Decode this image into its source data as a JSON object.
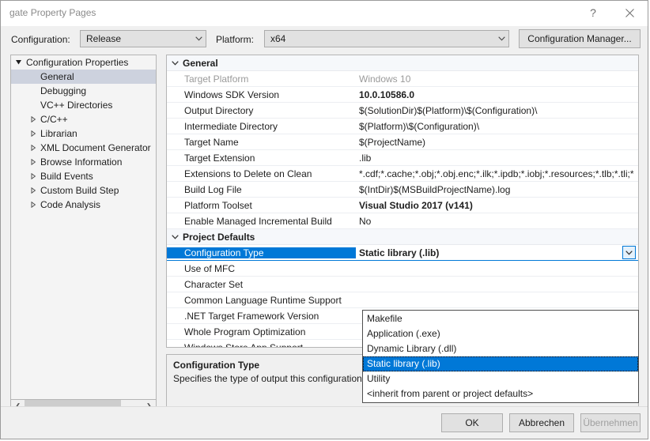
{
  "window": {
    "title": "gate Property Pages",
    "help_icon": "question-mark-icon",
    "close_icon": "close-icon"
  },
  "config_bar": {
    "configuration_label": "Configuration:",
    "configuration_value": "Release",
    "platform_label": "Platform:",
    "platform_value": "x64",
    "configuration_manager_label": "Configuration Manager..."
  },
  "tree": {
    "items": [
      {
        "label": "Configuration Properties",
        "indent": 0,
        "arrow": "expanded",
        "selected": false
      },
      {
        "label": "General",
        "indent": 1,
        "arrow": "none",
        "selected": true
      },
      {
        "label": "Debugging",
        "indent": 1,
        "arrow": "none",
        "selected": false
      },
      {
        "label": "VC++ Directories",
        "indent": 1,
        "arrow": "none",
        "selected": false
      },
      {
        "label": "C/C++",
        "indent": 1,
        "arrow": "collapsed",
        "selected": false
      },
      {
        "label": "Librarian",
        "indent": 1,
        "arrow": "collapsed",
        "selected": false
      },
      {
        "label": "XML Document Generator",
        "indent": 1,
        "arrow": "collapsed",
        "selected": false
      },
      {
        "label": "Browse Information",
        "indent": 1,
        "arrow": "collapsed",
        "selected": false
      },
      {
        "label": "Build Events",
        "indent": 1,
        "arrow": "collapsed",
        "selected": false
      },
      {
        "label": "Custom Build Step",
        "indent": 1,
        "arrow": "collapsed",
        "selected": false
      },
      {
        "label": "Code Analysis",
        "indent": 1,
        "arrow": "collapsed",
        "selected": false
      }
    ],
    "scrollbar": {
      "left_arrow_icon": "chevron-left-icon",
      "right_arrow_icon": "chevron-right-icon"
    }
  },
  "grid": {
    "sections": [
      {
        "title": "General",
        "expanded": true,
        "rows": [
          {
            "name": "Target Platform",
            "value": "Windows 10",
            "state": "readonly"
          },
          {
            "name": "Windows SDK Version",
            "value": "10.0.10586.0",
            "state": "bold"
          },
          {
            "name": "Output Directory",
            "value": "$(SolutionDir)$(Platform)\\$(Configuration)\\",
            "state": "normal"
          },
          {
            "name": "Intermediate Directory",
            "value": "$(Platform)\\$(Configuration)\\",
            "state": "normal"
          },
          {
            "name": "Target Name",
            "value": "$(ProjectName)",
            "state": "normal"
          },
          {
            "name": "Target Extension",
            "value": ".lib",
            "state": "normal"
          },
          {
            "name": "Extensions to Delete on Clean",
            "value": "*.cdf;*.cache;*.obj;*.obj.enc;*.ilk;*.ipdb;*.iobj;*.resources;*.tlb;*.tli;*",
            "state": "normal"
          },
          {
            "name": "Build Log File",
            "value": "$(IntDir)$(MSBuildProjectName).log",
            "state": "normal"
          },
          {
            "name": "Platform Toolset",
            "value": "Visual Studio 2017 (v141)",
            "state": "bold"
          },
          {
            "name": "Enable Managed Incremental Build",
            "value": "No",
            "state": "normal"
          }
        ]
      },
      {
        "title": "Project Defaults",
        "expanded": true,
        "rows": [
          {
            "name": "Configuration Type",
            "value": "Static library (.lib)",
            "state": "editing"
          },
          {
            "name": "Use of MFC",
            "value": "",
            "state": "normal"
          },
          {
            "name": "Character Set",
            "value": "",
            "state": "normal"
          },
          {
            "name": "Common Language Runtime Support",
            "value": "",
            "state": "normal"
          },
          {
            "name": ".NET Target Framework Version",
            "value": "",
            "state": "normal"
          },
          {
            "name": "Whole Program Optimization",
            "value": "",
            "state": "normal"
          },
          {
            "name": "Windows Store App Support",
            "value": "",
            "state": "normal"
          }
        ]
      }
    ],
    "expand_icon": "chevron-down-icon",
    "editor_dropdown_icon": "chevron-down-icon"
  },
  "dropdown": {
    "options": [
      "Makefile",
      "Application (.exe)",
      "Dynamic Library (.dll)",
      "Static library (.lib)",
      "Utility",
      "<inherit from parent or project defaults>"
    ],
    "selected_index": 3
  },
  "description": {
    "title": "Configuration Type",
    "text": "Specifies the type of output this configuration generates."
  },
  "footer": {
    "ok_label": "OK",
    "cancel_label": "Abbrechen",
    "apply_label": "Übernehmen",
    "apply_disabled": true
  },
  "colors": {
    "accent": "#0078D7",
    "tree_selection": "#CDD2DE",
    "window_bg": "#F0F0F0",
    "grid_bg": "#FFFFFF",
    "category_bg": "#F6F8FB"
  }
}
